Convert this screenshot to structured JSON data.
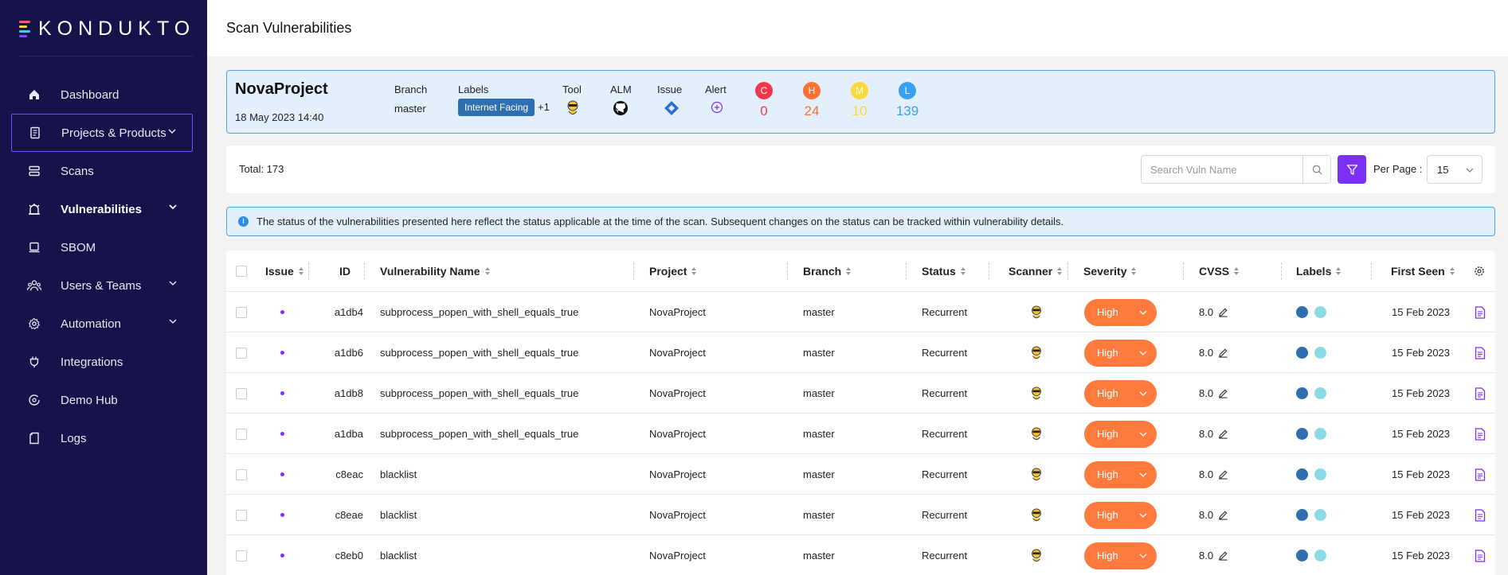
{
  "brand": {
    "name": "KONDUKTO"
  },
  "sidebar": {
    "items": [
      {
        "label": "Dashboard"
      },
      {
        "label": "Projects & Products"
      },
      {
        "label": "Scans"
      },
      {
        "label": "Vulnerabilities"
      },
      {
        "label": "SBOM"
      },
      {
        "label": "Users & Teams"
      },
      {
        "label": "Automation"
      },
      {
        "label": "Integrations"
      },
      {
        "label": "Demo Hub"
      },
      {
        "label": "Logs"
      }
    ]
  },
  "header": {
    "title": "Scan Vulnerabilities"
  },
  "project": {
    "name": "NovaProject",
    "date": "18 May 2023 14:40",
    "branch_label": "Branch",
    "branch": "master",
    "labels_label": "Labels",
    "label_chip": "Internet Facing",
    "label_more": "+1",
    "tool_label": "Tool",
    "alm_label": "ALM",
    "issue_label": "Issue",
    "alert_label": "Alert",
    "severity": [
      {
        "letter": "C",
        "count": "0",
        "color": "#f0384b"
      },
      {
        "letter": "H",
        "count": "24",
        "color": "#f97135"
      },
      {
        "letter": "M",
        "count": "10",
        "color": "#fbd73a"
      },
      {
        "letter": "L",
        "count": "139",
        "color": "#3aa0f0"
      }
    ]
  },
  "toolbar": {
    "total": "Total: 173",
    "search_placeholder": "Search Vuln Name",
    "per_page_label": "Per Page :",
    "per_page_value": "15"
  },
  "info": {
    "text": "The status of the vulnerabilities presented here reflect the status applicable at the time of the scan. Subsequent changes on the status can be tracked within vulnerability details."
  },
  "table": {
    "headers": {
      "issue": "Issue",
      "id": "ID",
      "name": "Vulnerability Name",
      "project": "Project",
      "branch": "Branch",
      "status": "Status",
      "scanner": "Scanner",
      "severity": "Severity",
      "cvss": "CVSS",
      "labels": "Labels",
      "first_seen": "First Seen"
    },
    "rows": [
      {
        "id": "a1db4",
        "name": "subprocess_popen_with_shell_equals_true",
        "project": "NovaProject",
        "branch": "master",
        "status": "Recurrent",
        "severity": "High",
        "cvss": "8.0",
        "first_seen": "15 Feb 2023"
      },
      {
        "id": "a1db6",
        "name": "subprocess_popen_with_shell_equals_true",
        "project": "NovaProject",
        "branch": "master",
        "status": "Recurrent",
        "severity": "High",
        "cvss": "8.0",
        "first_seen": "15 Feb 2023"
      },
      {
        "id": "a1db8",
        "name": "subprocess_popen_with_shell_equals_true",
        "project": "NovaProject",
        "branch": "master",
        "status": "Recurrent",
        "severity": "High",
        "cvss": "8.0",
        "first_seen": "15 Feb 2023"
      },
      {
        "id": "a1dba",
        "name": "subprocess_popen_with_shell_equals_true",
        "project": "NovaProject",
        "branch": "master",
        "status": "Recurrent",
        "severity": "High",
        "cvss": "8.0",
        "first_seen": "15 Feb 2023"
      },
      {
        "id": "c8eac",
        "name": "blacklist",
        "project": "NovaProject",
        "branch": "master",
        "status": "Recurrent",
        "severity": "High",
        "cvss": "8.0",
        "first_seen": "15 Feb 2023"
      },
      {
        "id": "c8eae",
        "name": "blacklist",
        "project": "NovaProject",
        "branch": "master",
        "status": "Recurrent",
        "severity": "High",
        "cvss": "8.0",
        "first_seen": "15 Feb 2023"
      },
      {
        "id": "c8eb0",
        "name": "blacklist",
        "project": "NovaProject",
        "branch": "master",
        "status": "Recurrent",
        "severity": "High",
        "cvss": "8.0",
        "first_seen": "15 Feb 2023"
      }
    ]
  },
  "colors": {
    "sidebar": "#16124a",
    "accent": "#7b2ff7",
    "high": "#ff7a3d",
    "info_bg": "#e3f0fb"
  }
}
